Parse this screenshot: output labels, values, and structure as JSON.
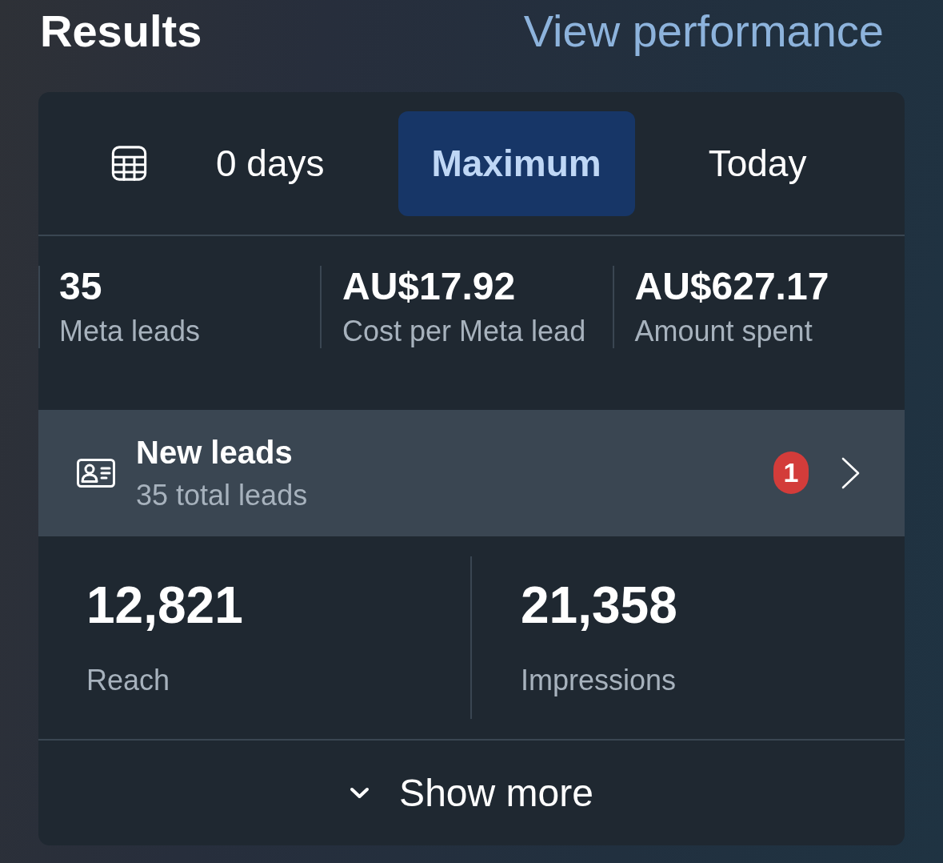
{
  "header": {
    "title": "Results",
    "link": "View performance"
  },
  "date_tabs": [
    {
      "label": "0 days",
      "selected": false
    },
    {
      "label": "Maximum",
      "selected": true
    },
    {
      "label": "Today",
      "selected": false
    }
  ],
  "summary_metrics": [
    {
      "value": "35",
      "label": "Meta leads"
    },
    {
      "value": "AU$17.92",
      "label": "Cost per Meta lead"
    },
    {
      "value": "AU$627.17",
      "label": "Amount spent"
    }
  ],
  "leads_row": {
    "title": "New leads",
    "subtitle": "35 total leads",
    "badge": "1"
  },
  "stats": [
    {
      "value": "12,821",
      "label": "Reach"
    },
    {
      "value": "21,358",
      "label": "Impressions"
    }
  ],
  "show_more": {
    "label": "Show more",
    "expanded": false
  }
}
